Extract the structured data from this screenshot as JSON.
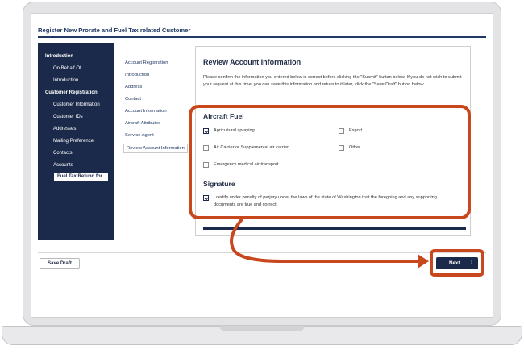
{
  "header": {
    "title": "Register New Prorate and Fuel Tax related Customer"
  },
  "left_nav": {
    "items": [
      {
        "label": "Introduction",
        "kind": "section"
      },
      {
        "label": "On Behalf Of",
        "kind": "item"
      },
      {
        "label": "Introduction",
        "kind": "item"
      },
      {
        "label": "Customer Registration",
        "kind": "section"
      },
      {
        "label": "Customer Information",
        "kind": "item"
      },
      {
        "label": "Customer IDs",
        "kind": "item"
      },
      {
        "label": "Addresses",
        "kind": "item"
      },
      {
        "label": "Mailing Preference",
        "kind": "item"
      },
      {
        "label": "Contacts",
        "kind": "item"
      },
      {
        "label": "Accounts",
        "kind": "item"
      },
      {
        "label": "Fuel Tax Refund for .",
        "kind": "active"
      }
    ]
  },
  "sub_nav": {
    "items": [
      {
        "label": "Account Registration"
      },
      {
        "label": "Introduction"
      },
      {
        "label": "Address"
      },
      {
        "label": "Contact"
      },
      {
        "label": "Account Information"
      },
      {
        "label": "Aircraft Attributes"
      },
      {
        "label": "Service Agent"
      },
      {
        "label": "Review Account Information",
        "active": true
      }
    ]
  },
  "review": {
    "title": "Review Account Information",
    "description": "Please confirm the information you entered below is correct before clicking the \"Submit\" button below. If you do not wish to submit your request at this time, you can save this information and return to it later, click the \"Save Draft\" button below."
  },
  "aircraft_fuel": {
    "heading": "Aircraft Fuel",
    "options": [
      {
        "label": "Agricultural spraying",
        "checked": true
      },
      {
        "label": "Export",
        "checked": false
      },
      {
        "label": "Air Carrier or Supplemental air carrier",
        "checked": false
      },
      {
        "label": "Other",
        "checked": false
      },
      {
        "label": "Emergency medical air transport",
        "checked": false
      }
    ]
  },
  "signature": {
    "heading": "Signature",
    "certify_label": "I certify under penalty of perjury under the laws of the state of Washington that the foregoing and any supporting documents are true and correct.",
    "checked": true
  },
  "footer": {
    "save_draft_label": "Save Draft",
    "next_label": "Next",
    "next_chevron": "›"
  },
  "colors": {
    "navy": "#1b2a4a",
    "highlight": "#c8471d"
  }
}
